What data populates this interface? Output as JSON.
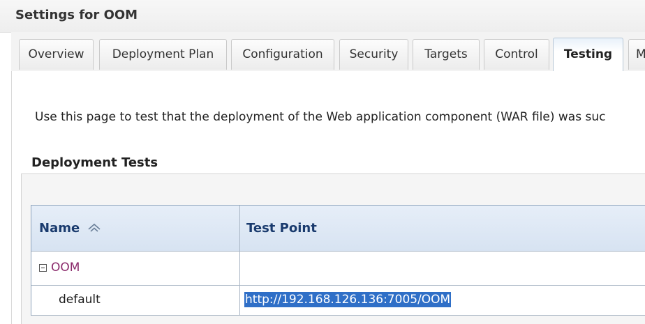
{
  "header": {
    "title": "Settings for OOM"
  },
  "tabs": [
    {
      "label": "Overview",
      "active": false
    },
    {
      "label": "Deployment Plan",
      "active": false
    },
    {
      "label": "Configuration",
      "active": false
    },
    {
      "label": "Security",
      "active": false
    },
    {
      "label": "Targets",
      "active": false
    },
    {
      "label": "Control",
      "active": false
    },
    {
      "label": "Testing",
      "active": true
    },
    {
      "label": "M",
      "active": false
    }
  ],
  "intro_text": "Use this page to test that the deployment of the Web application component (WAR file) was suc",
  "section": {
    "title": "Deployment Tests"
  },
  "table": {
    "columns": [
      "Name",
      "Test Point"
    ],
    "sort_icon": "sort-ascending-icon",
    "rows": [
      {
        "name": "OOM",
        "test_point": "",
        "kind": "group",
        "expanded": true
      },
      {
        "name": "default",
        "test_point": "http://192.168.126.136:7005/OOM",
        "kind": "child",
        "selected": true
      }
    ]
  },
  "colors": {
    "header_text": "#1a3b6e",
    "link": "#8a2a6b",
    "selection": "#2f6fc7"
  }
}
